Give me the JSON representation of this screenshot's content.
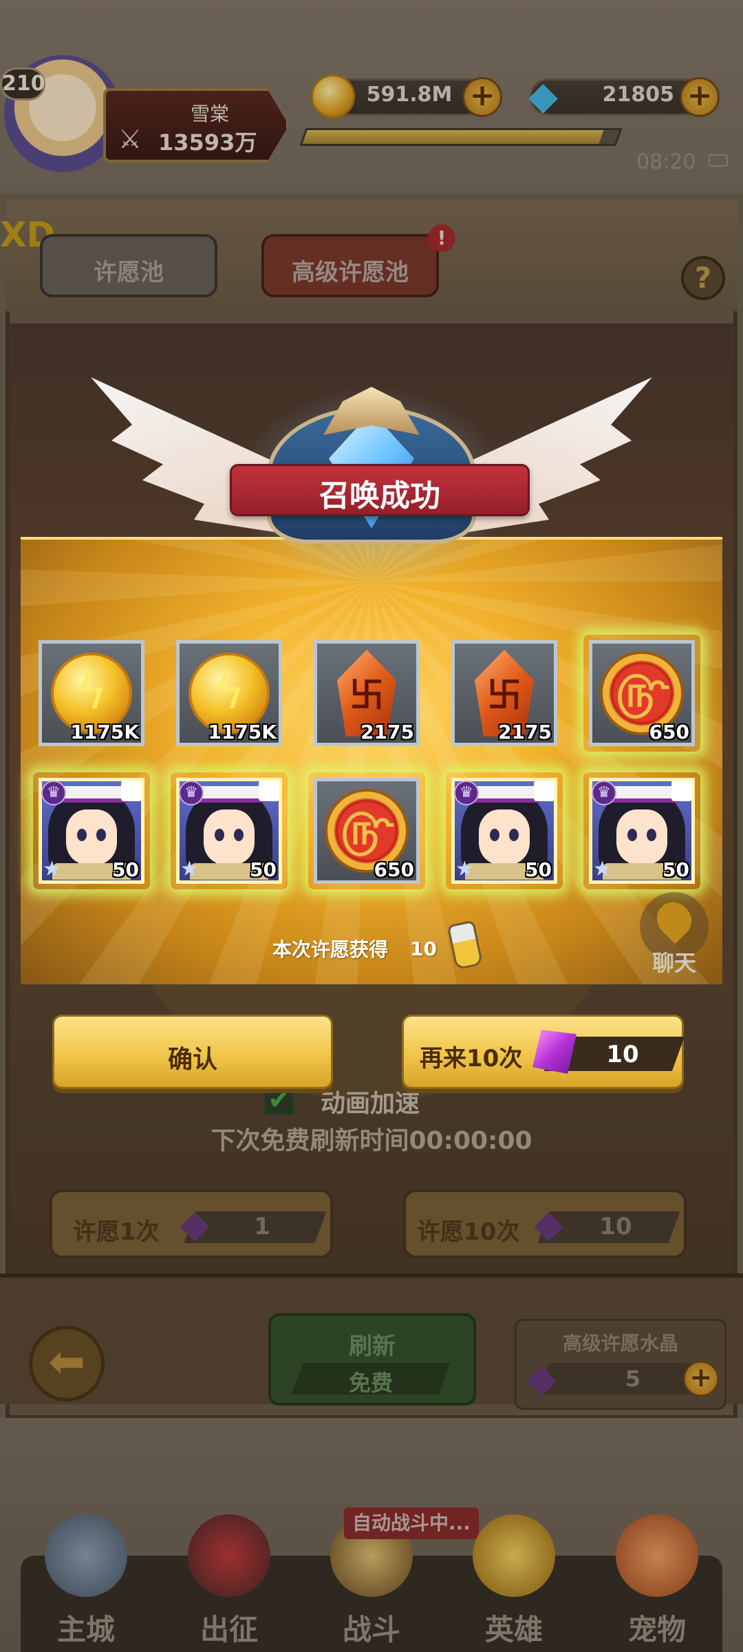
{
  "player": {
    "level": "210",
    "name": "雪棠",
    "power": "13593万"
  },
  "resources": {
    "gold": "591.8M",
    "gems": "21805",
    "exp_fraction": 0.95
  },
  "status": {
    "time": "08:20"
  },
  "tabs": {
    "normal": "许愿池",
    "advanced": "高级许愿池",
    "advanced_badge": "!"
  },
  "corner_text": "XD",
  "help": "?",
  "popup": {
    "title": "召唤成功",
    "rewards": [
      {
        "type": "gold-coin",
        "count": "1175K",
        "highlight": false
      },
      {
        "type": "gold-coin",
        "count": "1175K",
        "highlight": false
      },
      {
        "type": "fire-rune",
        "count": "2175",
        "highlight": false
      },
      {
        "type": "fire-rune",
        "count": "2175",
        "highlight": false
      },
      {
        "type": "red-coin",
        "count": "650",
        "highlight": true
      },
      {
        "type": "hero-shard",
        "count": "50",
        "highlight": true
      },
      {
        "type": "hero-shard",
        "count": "50",
        "highlight": true
      },
      {
        "type": "red-coin",
        "count": "650",
        "highlight": true
      },
      {
        "type": "hero-shard",
        "count": "50",
        "highlight": true
      },
      {
        "type": "hero-shard",
        "count": "50",
        "highlight": true
      }
    ],
    "gained_label": "本次许愿获得",
    "gained_count": "10",
    "confirm": "确认",
    "again": "再来10次",
    "again_cost": "10"
  },
  "chat": "聊天",
  "wish_panel": {
    "anim_speedup": "动画加速",
    "refresh_timer": "下次免费刷新时间00:00:00",
    "wish1_label": "许愿1次",
    "wish1_cost": "1",
    "wish10_label": "许愿10次",
    "wish10_cost": "10",
    "refresh_label": "刷新",
    "refresh_free": "免费",
    "crystal_title": "高级许愿水晶",
    "crystal_count": "5"
  },
  "nav": {
    "auto_battle": "自动战斗中...",
    "items": [
      "主城",
      "出征",
      "战斗",
      "英雄",
      "宠物"
    ]
  },
  "colors": {
    "banner_red": "#c2313c",
    "glow_gold": "#f2b12c",
    "button_gold": "#f0c54a"
  }
}
